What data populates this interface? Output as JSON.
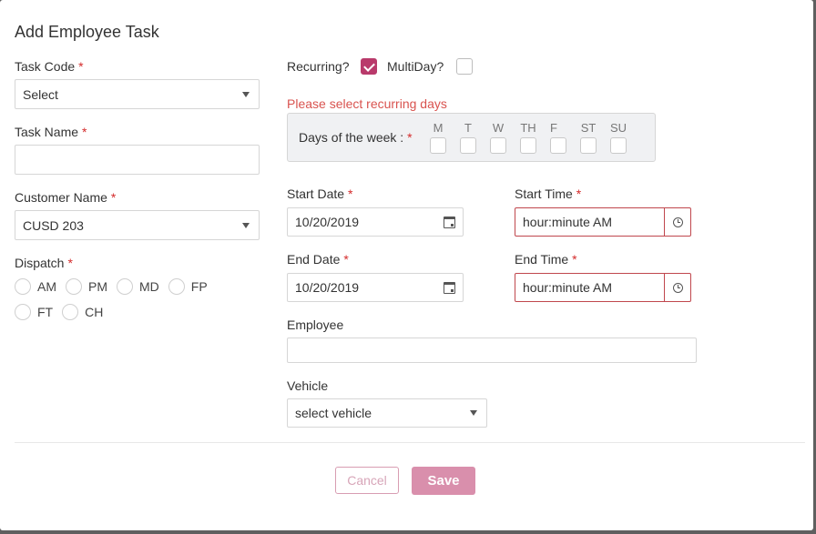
{
  "modal": {
    "title": "Add Employee Task"
  },
  "task_code": {
    "label": "Task Code",
    "required": "*",
    "value": "Select"
  },
  "task_name": {
    "label": "Task Name",
    "required": "*",
    "value": ""
  },
  "customer_name": {
    "label": "Customer Name",
    "required": "*",
    "value": "CUSD 203"
  },
  "dispatch": {
    "label": "Dispatch",
    "required": "*",
    "options": [
      "AM",
      "PM",
      "MD",
      "FP",
      "FT",
      "CH"
    ]
  },
  "recurring": {
    "label": "Recurring?",
    "checked": true
  },
  "multiday": {
    "label": "MultiDay?",
    "checked": false
  },
  "recurring_error": "Please select recurring days",
  "days_of_week": {
    "label": "Days of the week :",
    "required": "*",
    "days": [
      "M",
      "T",
      "W",
      "TH",
      "F",
      "ST",
      "SU"
    ]
  },
  "start_date": {
    "label": "Start Date",
    "required": "*",
    "value": "10/20/2019",
    "icon": "calendar-icon"
  },
  "start_time": {
    "label": "Start Time",
    "required": "*",
    "value": "hour:minute AM",
    "icon": "clock-icon"
  },
  "end_date": {
    "label": "End Date",
    "required": "*",
    "value": "10/20/2019",
    "icon": "calendar-icon"
  },
  "end_time": {
    "label": "End Time",
    "required": "*",
    "value": "hour:minute AM",
    "icon": "clock-icon"
  },
  "employee": {
    "label": "Employee",
    "value": ""
  },
  "vehicle": {
    "label": "Vehicle",
    "value": "select vehicle"
  },
  "actions": {
    "cancel_label": "Cancel",
    "save_label": "Save"
  },
  "colors": {
    "accent": "#b93a6b",
    "error": "#d9534f",
    "save_bg": "#d98fac"
  }
}
